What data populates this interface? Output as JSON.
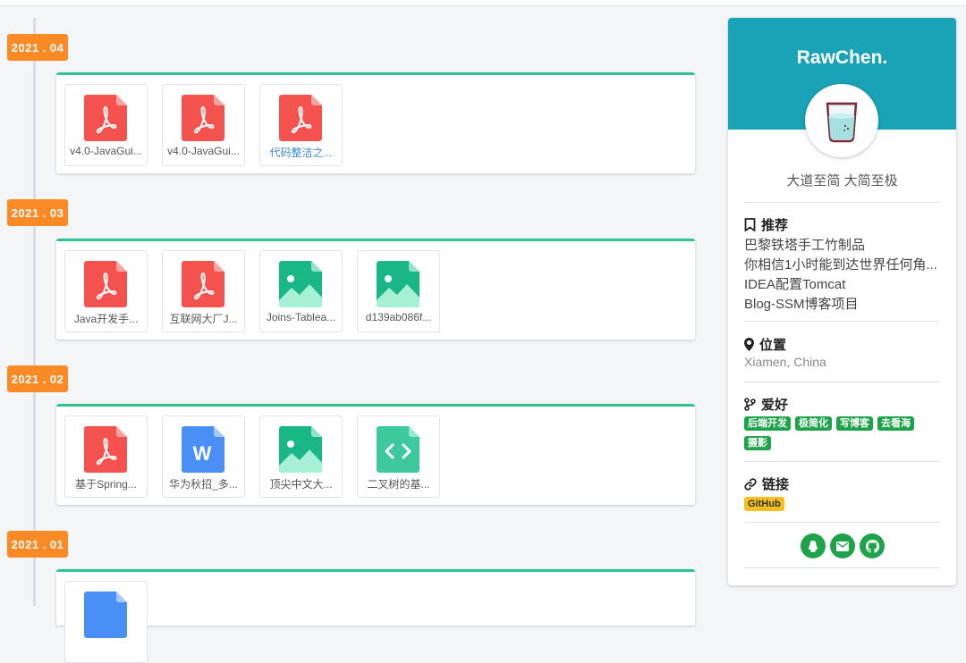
{
  "timeline": [
    {
      "date": "2021 . 04",
      "files": [
        {
          "name": "v4.0-JavaGui...",
          "type": "pdf",
          "link": false
        },
        {
          "name": "v4.0-JavaGui...",
          "type": "pdf",
          "link": false
        },
        {
          "name": "代码整洁之...",
          "type": "pdf",
          "link": true
        }
      ]
    },
    {
      "date": "2021 . 03",
      "files": [
        {
          "name": "Java开发手...",
          "type": "pdf",
          "link": false
        },
        {
          "name": "互联网大厂J...",
          "type": "pdf",
          "link": false
        },
        {
          "name": "Joins-Tablea...",
          "type": "image",
          "link": false
        },
        {
          "name": "d139ab086f...",
          "type": "image",
          "link": false
        }
      ]
    },
    {
      "date": "2021 . 02",
      "files": [
        {
          "name": "基于Spring...",
          "type": "pdf",
          "link": false
        },
        {
          "name": "华为秋招_多...",
          "type": "word",
          "link": false
        },
        {
          "name": "顶尖中文大...",
          "type": "image",
          "link": false
        },
        {
          "name": "二叉树的基...",
          "type": "code",
          "link": false
        }
      ]
    },
    {
      "date": "2021 . 01",
      "files": [
        {
          "name": "",
          "type": "word",
          "link": false
        }
      ]
    }
  ],
  "profile": {
    "name": "RawChen.",
    "motto": "大道至简 大简至极",
    "recommend_title": "推荐",
    "recommend": [
      "巴黎铁塔手工竹制品",
      "你相信1小时能到达世界任何角...",
      "IDEA配置Tomcat",
      "Blog-SSM博客项目"
    ],
    "location_title": "位置",
    "location": "Xiamen, China",
    "hobby_title": "爱好",
    "hobbies": [
      "后端开发",
      "极简化",
      "写博客",
      "去看海",
      "摄影"
    ],
    "links_title": "链接",
    "links": [
      "GitHub"
    ]
  },
  "colors": {
    "date_badge": "#fa8a26",
    "card_accent": "#2ec48f",
    "sidebar_header": "#1aa3b6",
    "tag": "#1fa34a",
    "link_tag": "#f4c021",
    "pdf": "#f4524f",
    "image": "#19b786",
    "word": "#4a8ff5",
    "code": "#3ec89e"
  },
  "icons": {
    "recommend": "bookmark-icon",
    "location": "map-marker-icon",
    "hobby": "code-branch-icon",
    "links": "link-icon",
    "social": [
      "qq-icon",
      "envelope-icon",
      "github-icon"
    ]
  }
}
